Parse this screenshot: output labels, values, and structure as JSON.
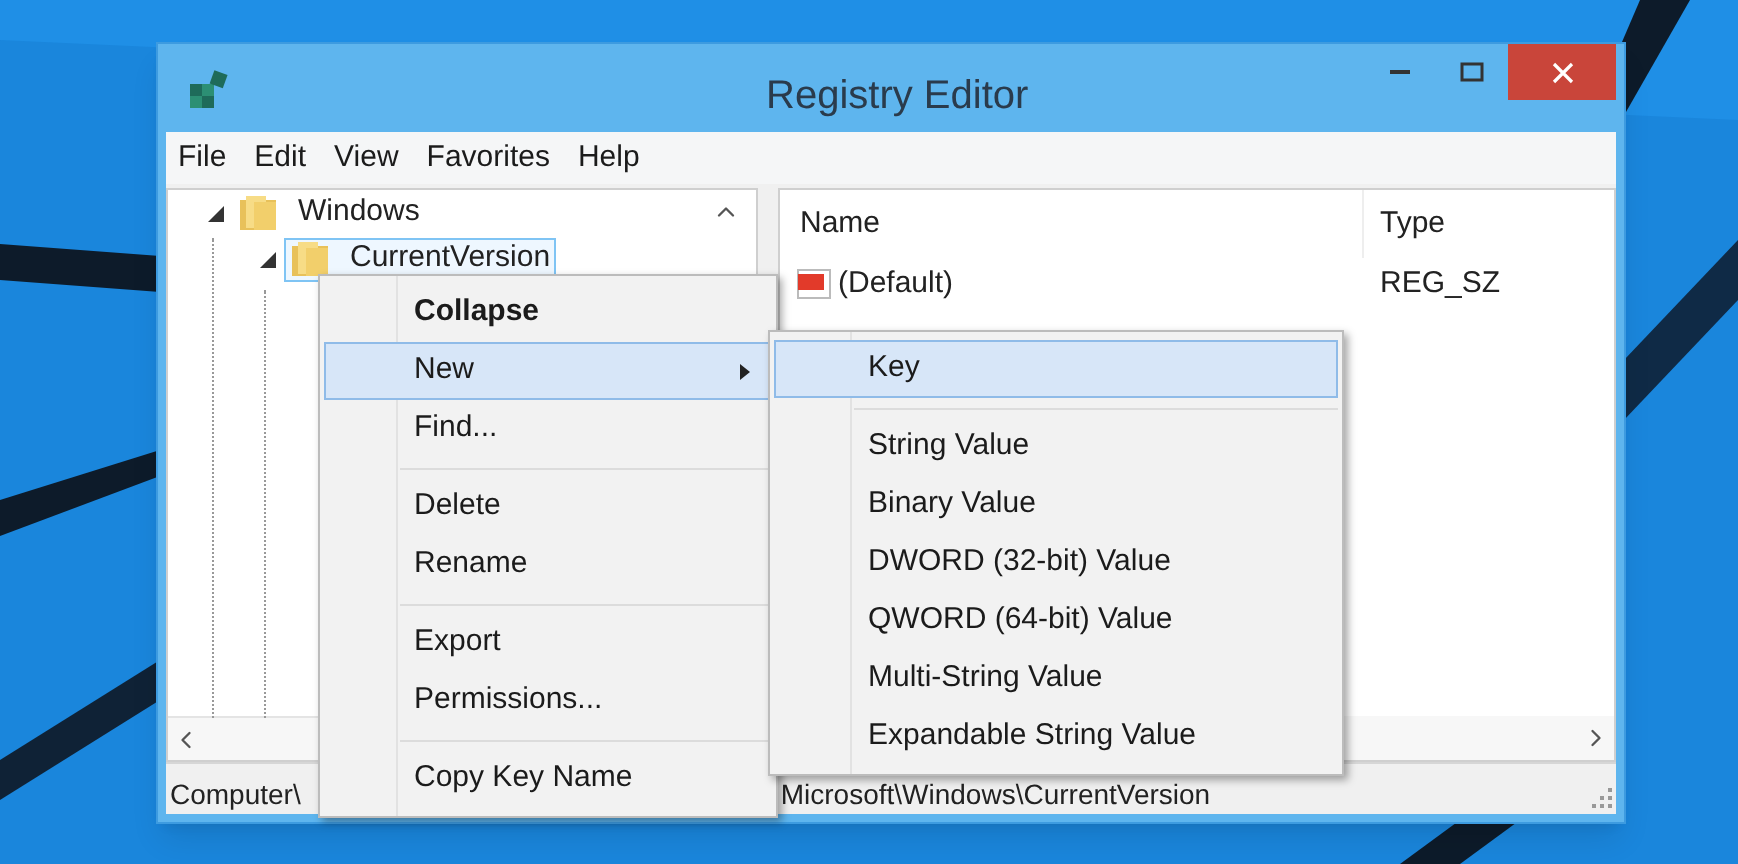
{
  "window": {
    "title": "Registry Editor"
  },
  "menu_bar": [
    "File",
    "Edit",
    "View",
    "Favorites",
    "Help"
  ],
  "tree": {
    "items": [
      {
        "label": "Windows",
        "expanded": true,
        "selected": false,
        "children": [
          {
            "label": "CurrentVersion",
            "expanded": true,
            "selected": true
          }
        ]
      }
    ]
  },
  "values_table": {
    "columns": [
      "Name",
      "Type"
    ],
    "rows": [
      {
        "name": "(Default)",
        "type": "REG_SZ"
      }
    ]
  },
  "context_menu": {
    "items": [
      {
        "kind": "item",
        "label": "Collapse",
        "default": true,
        "selected": false,
        "submenu": false
      },
      {
        "kind": "item",
        "label": "New",
        "default": false,
        "selected": true,
        "submenu": true
      },
      {
        "kind": "item",
        "label": "Find...",
        "default": false,
        "selected": false,
        "submenu": false
      },
      {
        "kind": "separator"
      },
      {
        "kind": "item",
        "label": "Delete",
        "default": false,
        "selected": false,
        "submenu": false
      },
      {
        "kind": "item",
        "label": "Rename",
        "default": false,
        "selected": false,
        "submenu": false
      },
      {
        "kind": "separator"
      },
      {
        "kind": "item",
        "label": "Export",
        "default": false,
        "selected": false,
        "submenu": false
      },
      {
        "kind": "item",
        "label": "Permissions...",
        "default": false,
        "selected": false,
        "submenu": false
      },
      {
        "kind": "separator"
      },
      {
        "kind": "item",
        "label": "Copy Key Name",
        "default": false,
        "selected": false,
        "submenu": false
      }
    ]
  },
  "submenu": {
    "items": [
      {
        "kind": "item",
        "label": "Key",
        "default": false,
        "selected": true,
        "submenu": false
      },
      {
        "kind": "separator"
      },
      {
        "kind": "item",
        "label": "String Value",
        "default": false,
        "selected": false,
        "submenu": false
      },
      {
        "kind": "item",
        "label": "Binary Value",
        "default": false,
        "selected": false,
        "submenu": false
      },
      {
        "kind": "item",
        "label": "DWORD (32-bit) Value",
        "default": false,
        "selected": false,
        "submenu": false
      },
      {
        "kind": "item",
        "label": "QWORD (64-bit) Value",
        "default": false,
        "selected": false,
        "submenu": false
      },
      {
        "kind": "item",
        "label": "Multi-String Value",
        "default": false,
        "selected": false,
        "submenu": false
      },
      {
        "kind": "item",
        "label": "Expandable String Value",
        "default": false,
        "selected": false,
        "submenu": false
      }
    ]
  },
  "status_bar": [
    "Computer\\",
    "Microsoft\\Windows\\CurrentVersion"
  ]
}
